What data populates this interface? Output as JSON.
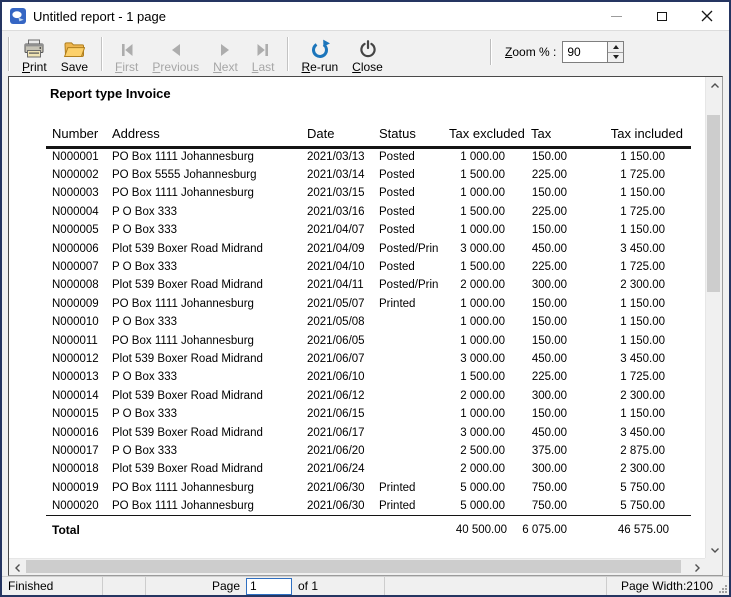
{
  "colors": {
    "window_border": "#253561",
    "accent_blue": "#2f6fc1",
    "rerun_blue": "#1b75bb",
    "save_yellow": "#f7c04a",
    "disabled_gray": "#a6a6a6"
  },
  "window": {
    "title": "Untitled report - 1 page"
  },
  "toolbar": {
    "print": "Print",
    "save": "Save",
    "first": "First",
    "previous": "Previous",
    "next": "Next",
    "last": "Last",
    "rerun": "Re-run",
    "close": "Close",
    "zoom_label": "Zoom % :",
    "zoom_value": "90"
  },
  "report": {
    "heading": "Report type Invoice",
    "columns": [
      "Number",
      "Address",
      "Date",
      "Status",
      "Tax excluded",
      "Tax",
      "Tax included"
    ],
    "rows": [
      [
        "N000001",
        "PO Box 1111 Johannesburg",
        "2021/03/13",
        "Posted",
        "1 000.00",
        "150.00",
        "1 150.00"
      ],
      [
        "N000002",
        "PO Box 5555 Johannesburg",
        "2021/03/14",
        "Posted",
        "1 500.00",
        "225.00",
        "1 725.00"
      ],
      [
        "N000003",
        "PO Box 1111 Johannesburg",
        "2021/03/15",
        "Posted",
        "1 000.00",
        "150.00",
        "1 150.00"
      ],
      [
        "N000004",
        "P O Box 333",
        "2021/03/16",
        "Posted",
        "1 500.00",
        "225.00",
        "1 725.00"
      ],
      [
        "N000005",
        "P O Box 333",
        "2021/04/07",
        "Posted",
        "1 000.00",
        "150.00",
        "1 150.00"
      ],
      [
        "N000006",
        "Plot 539 Boxer Road Midrand",
        "2021/04/09",
        "Posted/Prin",
        "3 000.00",
        "450.00",
        "3 450.00"
      ],
      [
        "N000007",
        "P O Box 333",
        "2021/04/10",
        "Posted",
        "1 500.00",
        "225.00",
        "1 725.00"
      ],
      [
        "N000008",
        "Plot 539 Boxer Road Midrand",
        "2021/04/11",
        "Posted/Prin",
        "2 000.00",
        "300.00",
        "2 300.00"
      ],
      [
        "N000009",
        "PO Box 1111 Johannesburg",
        "2021/05/07",
        "Printed",
        "1 000.00",
        "150.00",
        "1 150.00"
      ],
      [
        "N000010",
        "P O Box 333",
        "2021/05/08",
        "",
        "1 000.00",
        "150.00",
        "1 150.00"
      ],
      [
        "N000011",
        "PO Box 1111 Johannesburg",
        "2021/06/05",
        "",
        "1 000.00",
        "150.00",
        "1 150.00"
      ],
      [
        "N000012",
        "Plot 539 Boxer Road Midrand",
        "2021/06/07",
        "",
        "3 000.00",
        "450.00",
        "3 450.00"
      ],
      [
        "N000013",
        "P O Box 333",
        "2021/06/10",
        "",
        "1 500.00",
        "225.00",
        "1 725.00"
      ],
      [
        "N000014",
        "Plot 539 Boxer Road Midrand",
        "2021/06/12",
        "",
        "2 000.00",
        "300.00",
        "2 300.00"
      ],
      [
        "N000015",
        "P O Box 333",
        "2021/06/15",
        "",
        "1 000.00",
        "150.00",
        "1 150.00"
      ],
      [
        "N000016",
        "Plot 539 Boxer Road Midrand",
        "2021/06/17",
        "",
        "3 000.00",
        "450.00",
        "3 450.00"
      ],
      [
        "N000017",
        "P O Box 333",
        "2021/06/20",
        "",
        "2 500.00",
        "375.00",
        "2 875.00"
      ],
      [
        "N000018",
        "Plot 539 Boxer Road Midrand",
        "2021/06/24",
        "",
        "2 000.00",
        "300.00",
        "2 300.00"
      ],
      [
        "N000019",
        "PO Box 1111 Johannesburg",
        "2021/06/30",
        "Printed",
        "5 000.00",
        "750.00",
        "5 750.00"
      ],
      [
        "N000020",
        "PO Box 1111 Johannesburg",
        "2021/06/30",
        "Printed",
        "5 000.00",
        "750.00",
        "5 750.00"
      ]
    ],
    "total_label": "Total",
    "totals": [
      "40 500.00",
      "6 075.00",
      "46 575.00"
    ]
  },
  "statusbar": {
    "status": "Finished",
    "page_label": "Page",
    "page_value": "1",
    "of_label": "of 1",
    "page_width": "Page Width:2100"
  }
}
